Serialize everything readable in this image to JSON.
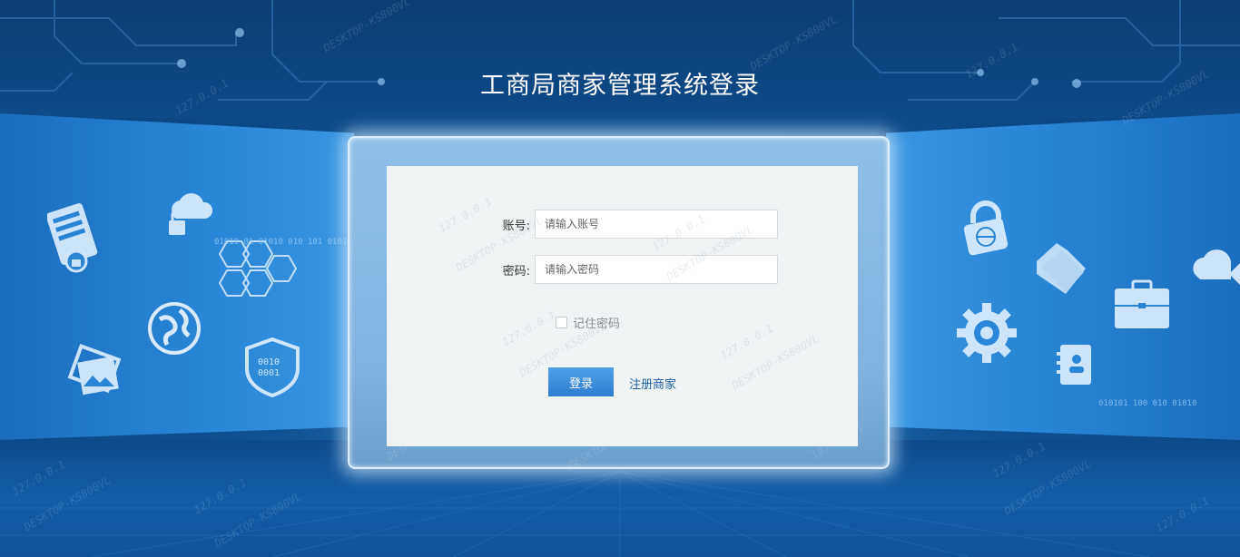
{
  "page": {
    "title": "工商局商家管理系统登录"
  },
  "form": {
    "account_label": "账号:",
    "account_placeholder": "请输入账号",
    "password_label": "密码:",
    "password_placeholder": "请输入密码",
    "remember_label": "记住密码",
    "remember_checked": false,
    "login_button": "登录",
    "register_link": "注册商家"
  },
  "watermark": {
    "ip": "127.0.0.1",
    "host": "DESKTOP-KS800VL"
  },
  "decorations": {
    "left_binary": "01010 01 01010 010 101 01010",
    "right_binary": "010101 100 010 01010",
    "shield_text_1": "0010",
    "shield_text_2": "0001"
  },
  "colors": {
    "accent": "#2f7fd0",
    "title": "#ffffff",
    "background": "#0e4f8f"
  }
}
